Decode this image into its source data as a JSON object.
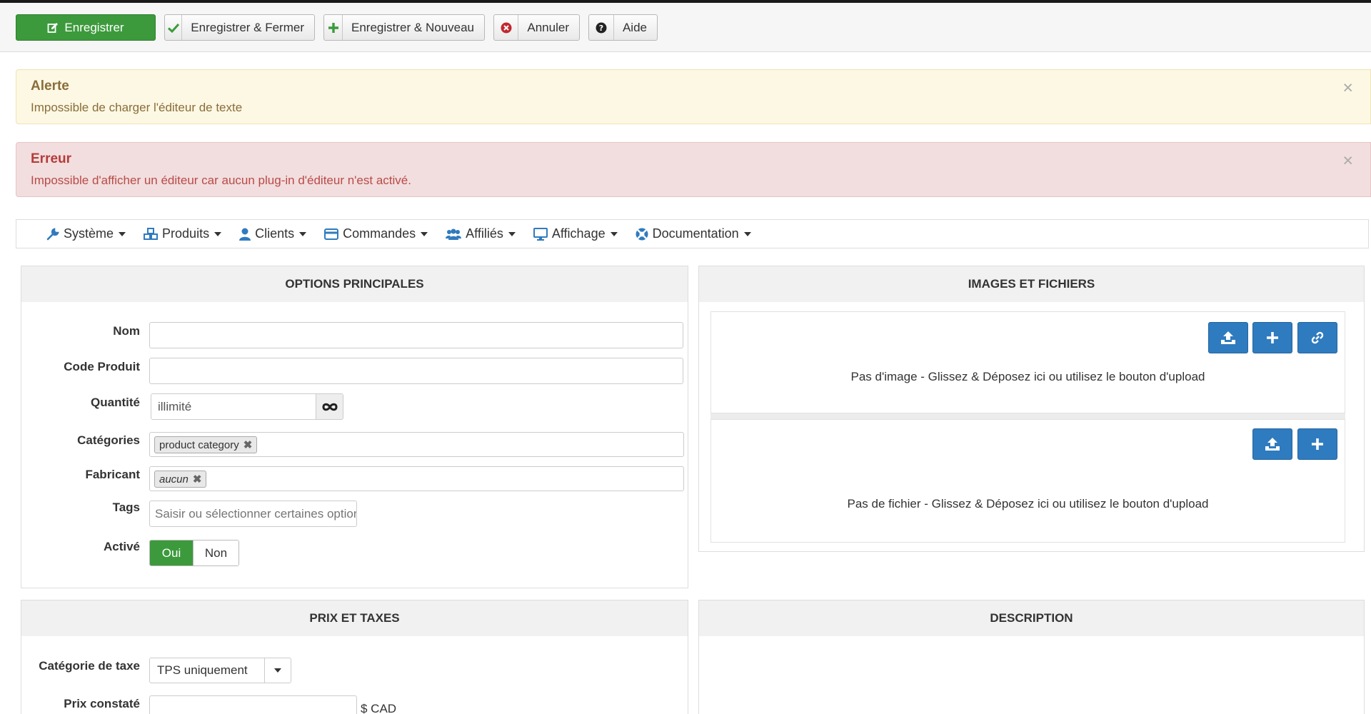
{
  "toolbar": {
    "save": "Enregistrer",
    "save_close": "Enregistrer & Fermer",
    "save_new": "Enregistrer & Nouveau",
    "cancel": "Annuler",
    "help": "Aide"
  },
  "alerts": {
    "warning": {
      "title": "Alerte",
      "message": "Impossible de charger l'éditeur de texte",
      "close": "×"
    },
    "error": {
      "title": "Erreur",
      "message": "Impossible d'afficher un éditeur car aucun plug-in d'éditeur n'est activé.",
      "close": "×"
    }
  },
  "menu": {
    "items": [
      {
        "label": "Système",
        "icon": "wrench-icon"
      },
      {
        "label": "Produits",
        "icon": "cubes-icon"
      },
      {
        "label": "Clients",
        "icon": "user-icon"
      },
      {
        "label": "Commandes",
        "icon": "credit-card-icon"
      },
      {
        "label": "Affiliés",
        "icon": "users-icon"
      },
      {
        "label": "Affichage",
        "icon": "desktop-icon"
      },
      {
        "label": "Documentation",
        "icon": "life-ring-icon"
      }
    ]
  },
  "main_options": {
    "title": "OPTIONS PRINCIPALES",
    "name_label": "Nom",
    "name_value": "",
    "code_label": "Code Produit",
    "code_value": "",
    "qty_label": "Quantité",
    "qty_value": "illimité",
    "categories_label": "Catégories",
    "categories_tag": "product category",
    "manufacturer_label": "Fabricant",
    "manufacturer_tag": "aucun",
    "tags_label": "Tags",
    "tags_placeholder": "Saisir ou sélectionner certaines options",
    "active_label": "Activé",
    "active_yes": "Oui",
    "active_no": "Non"
  },
  "images_files": {
    "title": "IMAGES ET FICHIERS",
    "no_image": "Pas d'image - Glissez & Déposez ici ou utilisez le bouton d'upload",
    "no_file": "Pas de fichier - Glissez & Déposez ici ou utilisez le bouton d'upload"
  },
  "price_taxes": {
    "title": "PRIX ET TAXES",
    "tax_label": "Catégorie de taxe",
    "tax_value": "TPS uniquement",
    "price_label": "Prix constaté",
    "price_value": "",
    "currency": "$ CAD"
  },
  "description": {
    "title": "DESCRIPTION"
  },
  "colors": {
    "primary_green": "#3c9a3c",
    "action_blue": "#2f7bbf",
    "warning_bg": "#fcf8e3",
    "error_bg": "#f2dede"
  }
}
